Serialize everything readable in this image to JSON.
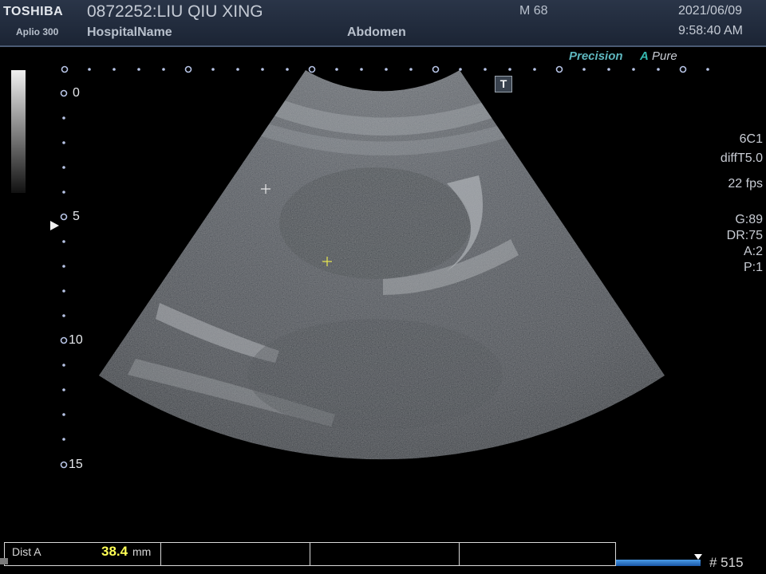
{
  "header": {
    "brand": "TOSHIBA",
    "model": "Aplio 300",
    "patient": "0872252:LIU QIU XING",
    "hospital": "HospitalName",
    "exam": "Abdomen",
    "age_sex": "M 68",
    "date": "2021/06/09",
    "time": "9:58:40 AM"
  },
  "processing": {
    "precision": "Precision",
    "apure_a": "A",
    "apure_text": "Pure"
  },
  "t_marker": "T",
  "depth_scale": {
    "labels": [
      "0",
      "5",
      "10",
      "15"
    ],
    "focus_depth": 5
  },
  "params": {
    "probe": "6C1",
    "mode": "diffT5.0",
    "fps": "22 fps",
    "gain": "G:89",
    "dr": "DR:75",
    "a": "A:2",
    "p": "P:1"
  },
  "measurement": {
    "label": "Dist A",
    "value": "38.4",
    "unit": "mm"
  },
  "cine": {
    "frame": "# 515",
    "progress": 0.96
  },
  "colors": {
    "header_bg": "#1b2434",
    "accent_teal": "#36b9b0",
    "measure_yellow": "#ffff55",
    "cine_blue": "#2a78d0"
  }
}
